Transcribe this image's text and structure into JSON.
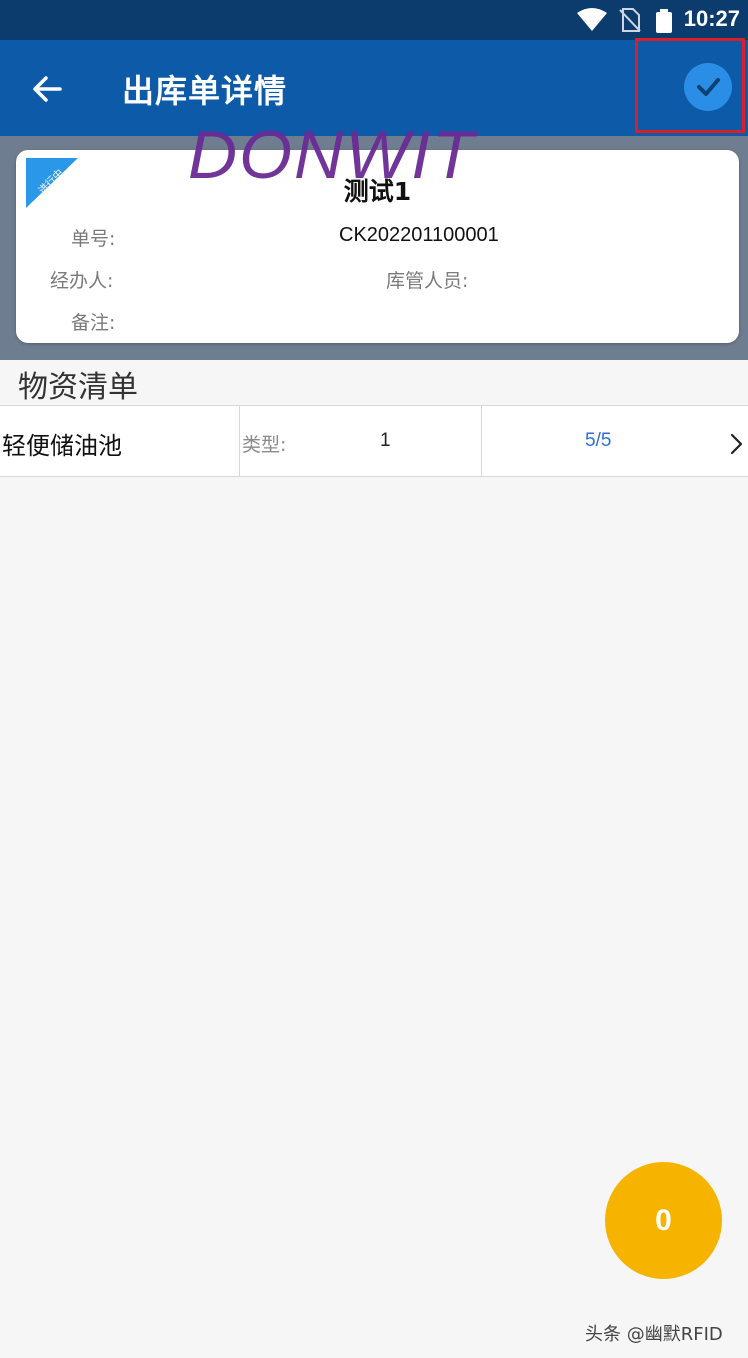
{
  "status_bar": {
    "time": "10:27",
    "icons": [
      "wifi-icon",
      "no-sim-icon",
      "battery-icon"
    ]
  },
  "app_bar": {
    "title": "出库单详情",
    "back_icon": "arrow-left-icon",
    "confirm_icon": "check-circle-icon"
  },
  "watermark": "DONWIT",
  "card": {
    "status_badge": "进行中",
    "name": "测试1",
    "order_no_label": "单号:",
    "order_no": "CK202201100001",
    "handler_label": "经办人:",
    "handler": "",
    "keeper_label": "库管人员:",
    "keeper": "",
    "remark_label": "备注:",
    "remark": ""
  },
  "materials": {
    "title": "物资清单",
    "items": [
      {
        "name": "轻便储油池",
        "type_label": "类型:",
        "type_value": "1",
        "progress": "5/5"
      }
    ]
  },
  "fab": {
    "count": "0"
  },
  "credit": "头条 @幽默RFID",
  "colors": {
    "app_bar": "#0d5aa8",
    "status_bar": "#0c3b6d",
    "accent_blue": "#2a8ee6",
    "fab": "#f6b400",
    "highlight_red": "#d9202a",
    "watermark": "#6a2b95"
  }
}
